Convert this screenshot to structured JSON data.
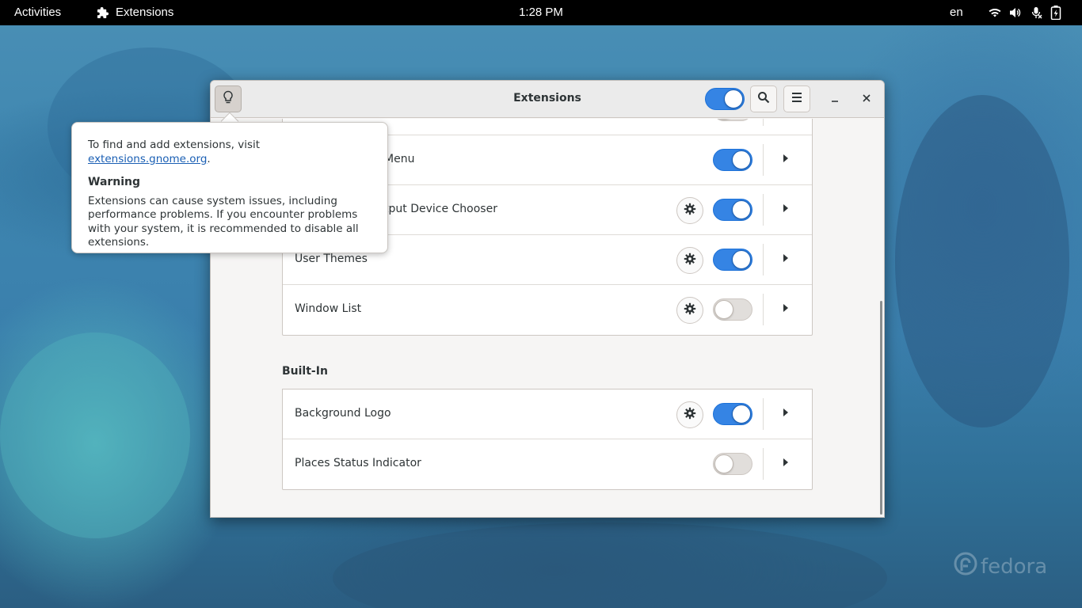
{
  "topbar": {
    "activities": "Activities",
    "app_name": "Extensions",
    "clock": "1:28 PM",
    "language": "en",
    "tray_icons": [
      "wifi-icon",
      "volume-icon",
      "mic-muted-icon",
      "battery-icon"
    ]
  },
  "window": {
    "title": "Extensions",
    "global_switch_on": true
  },
  "popover": {
    "intro_prefix": "To find and add extensions, visit ",
    "link": "extensions.gnome.org",
    "intro_suffix": ".",
    "warning_title": "Warning",
    "warning_body": "Extensions can cause system issues, including performance problems. If you encounter problems with your system, it is recommended to disable all extensions."
  },
  "user_extensions": [
    {
      "label": "Menu",
      "has_settings": false,
      "enabled": true
    },
    {
      "label": "tput Device Chooser",
      "has_settings": true,
      "enabled": true
    },
    {
      "label": "User Themes",
      "has_settings": true,
      "enabled": true
    },
    {
      "label": "Window List",
      "has_settings": true,
      "enabled": false
    }
  ],
  "builtin": {
    "title": "Built-In",
    "items": [
      {
        "label": "Background Logo",
        "has_settings": true,
        "enabled": true
      },
      {
        "label": "Places Status Indicator",
        "has_settings": false,
        "enabled": false
      }
    ]
  },
  "watermark": "fedora",
  "colors": {
    "accent": "#3584e4",
    "link": "#1a5fb4",
    "topbar": "#000000"
  }
}
